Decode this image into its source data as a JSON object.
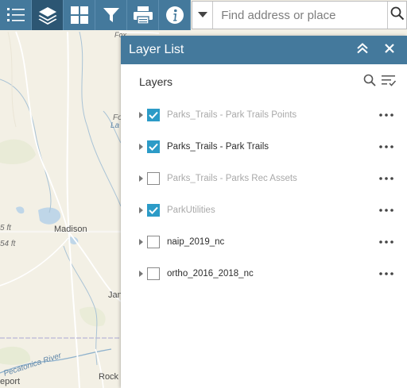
{
  "toolbar": {
    "buttons": [
      {
        "icon": "layer-legend-icon"
      },
      {
        "icon": "layers-icon"
      },
      {
        "icon": "basemap-gallery-icon"
      },
      {
        "icon": "filter-icon"
      },
      {
        "icon": "print-icon"
      },
      {
        "icon": "info-icon"
      }
    ],
    "active_color": "#2c5673",
    "bar_color": "#44799c"
  },
  "search": {
    "placeholder": "Find address or place",
    "value": ""
  },
  "panel": {
    "title": "Layer List",
    "heading": "Layers",
    "header_color": "#44799c",
    "checkbox_color": "#2c9bc7",
    "layers": [
      {
        "name": "Parks_Trails - Park Trails Points",
        "checked": true,
        "dimmed": true
      },
      {
        "name": "Parks_Trails - Park Trails",
        "checked": true,
        "dimmed": false
      },
      {
        "name": "Parks_Trails - Parks Rec Assets",
        "checked": false,
        "dimmed": true
      },
      {
        "name": "ParkUtilities",
        "checked": true,
        "dimmed": true
      },
      {
        "name": "naip_2019_nc",
        "checked": false,
        "dimmed": false
      },
      {
        "name": "ortho_2016_2018_nc",
        "checked": false,
        "dimmed": false
      }
    ]
  },
  "map": {
    "labels": {
      "madison": "Madison",
      "elev_1": "5 ft",
      "elev_2": "54 ft",
      "pecatonica": "Pecatonica River",
      "rock": "Rock",
      "report": "eport",
      "jan": "Jan",
      "fo": "Fo",
      "fox": "Fox",
      "la": "La"
    }
  }
}
